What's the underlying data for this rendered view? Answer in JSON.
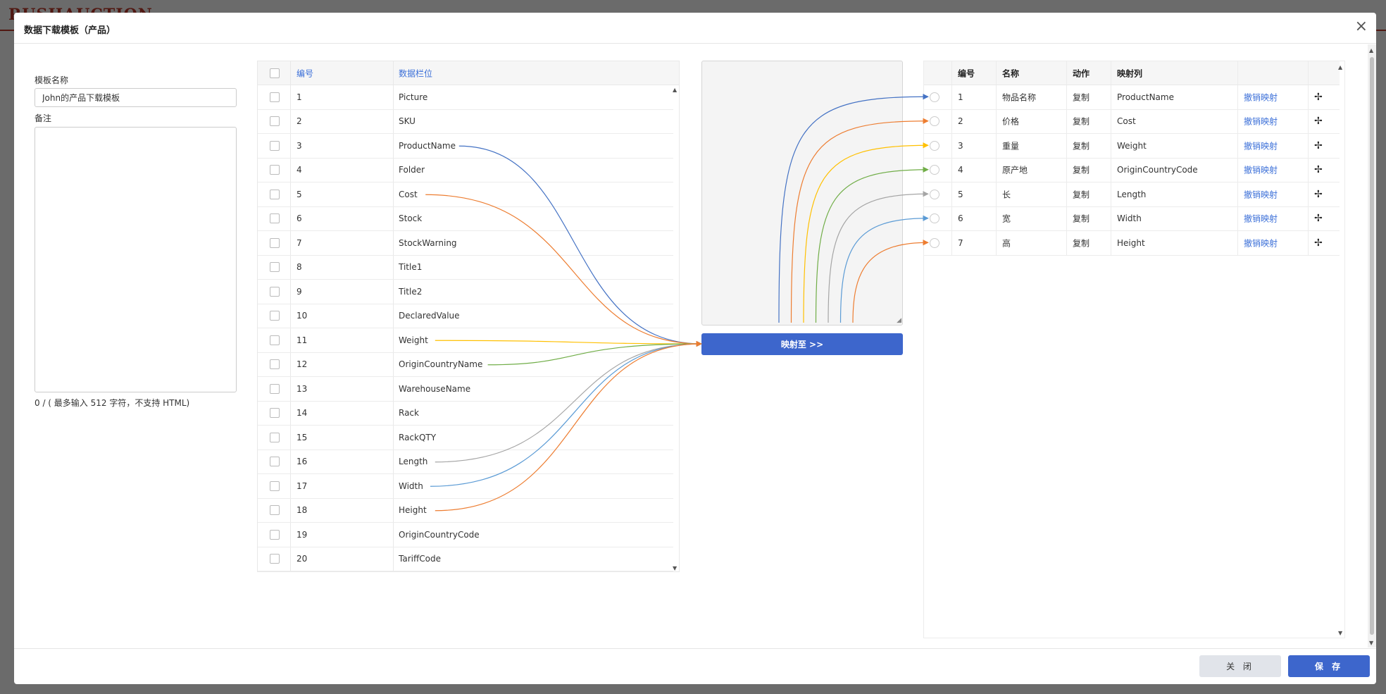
{
  "modal": {
    "title": "数据下载模板（产品）",
    "close_icon": "×"
  },
  "form": {
    "name_label": "模板名称",
    "name_value": "John的产品下载模板",
    "remark_label": "备注",
    "remark_value": "",
    "hint": "0 / ( 最多输入 512 字符，不支持 HTML)"
  },
  "source_table": {
    "col_no": "编号",
    "col_field": "数据栏位",
    "rows": [
      {
        "no": "1",
        "field": "Picture"
      },
      {
        "no": "2",
        "field": "SKU"
      },
      {
        "no": "3",
        "field": "ProductName"
      },
      {
        "no": "4",
        "field": "Folder"
      },
      {
        "no": "5",
        "field": "Cost"
      },
      {
        "no": "6",
        "field": "Stock"
      },
      {
        "no": "7",
        "field": "StockWarning"
      },
      {
        "no": "8",
        "field": "Title1"
      },
      {
        "no": "9",
        "field": "Title2"
      },
      {
        "no": "10",
        "field": "DeclaredValue"
      },
      {
        "no": "11",
        "field": "Weight"
      },
      {
        "no": "12",
        "field": "OriginCountryName"
      },
      {
        "no": "13",
        "field": "WarehouseName"
      },
      {
        "no": "14",
        "field": "Rack"
      },
      {
        "no": "15",
        "field": "RackQTY"
      },
      {
        "no": "16",
        "field": "Length"
      },
      {
        "no": "17",
        "field": "Width"
      },
      {
        "no": "18",
        "field": "Height"
      },
      {
        "no": "19",
        "field": "OriginCountryCode"
      },
      {
        "no": "20",
        "field": "TariffCode"
      }
    ]
  },
  "map_button": "映射至 >>",
  "target_table": {
    "col_no": "编号",
    "col_name": "名称",
    "col_action": "动作",
    "col_map": "映射列",
    "rows": [
      {
        "no": "1",
        "name": "物品名称",
        "action": "复制",
        "map": "ProductName",
        "undo": "撤销映射",
        "color": "#4472c4"
      },
      {
        "no": "2",
        "name": "价格",
        "action": "复制",
        "map": "Cost",
        "undo": "撤销映射",
        "color": "#ed7d31"
      },
      {
        "no": "3",
        "name": "重量",
        "action": "复制",
        "map": "Weight",
        "undo": "撤销映射",
        "color": "#ffc000"
      },
      {
        "no": "4",
        "name": "原产地",
        "action": "复制",
        "map": "OriginCountryCode",
        "undo": "撤销映射",
        "color": "#70ad47"
      },
      {
        "no": "5",
        "name": "长",
        "action": "复制",
        "map": "Length",
        "undo": "撤销映射",
        "color": "#a5a5a5"
      },
      {
        "no": "6",
        "name": "宽",
        "action": "复制",
        "map": "Width",
        "undo": "撤销映射",
        "color": "#5b9bd5"
      },
      {
        "no": "7",
        "name": "高",
        "action": "复制",
        "map": "Height",
        "undo": "撤销映射",
        "color": "#ed7d31"
      }
    ]
  },
  "source_links": [
    {
      "from": "ProductName",
      "color": "#4472c4"
    },
    {
      "from": "Cost",
      "color": "#ed7d31"
    },
    {
      "from": "Weight",
      "color": "#ffc000"
    },
    {
      "from": "OriginCountryName",
      "color": "#70ad47"
    },
    {
      "from": "Length",
      "color": "#a5a5a5"
    },
    {
      "from": "Width",
      "color": "#5b9bd5"
    },
    {
      "from": "Height",
      "color": "#ed7d31"
    }
  ],
  "footer": {
    "close_label": "关 闭",
    "save_label": "保 存"
  },
  "icons": {
    "move": "move-arrows-icon",
    "close": "close-icon"
  }
}
